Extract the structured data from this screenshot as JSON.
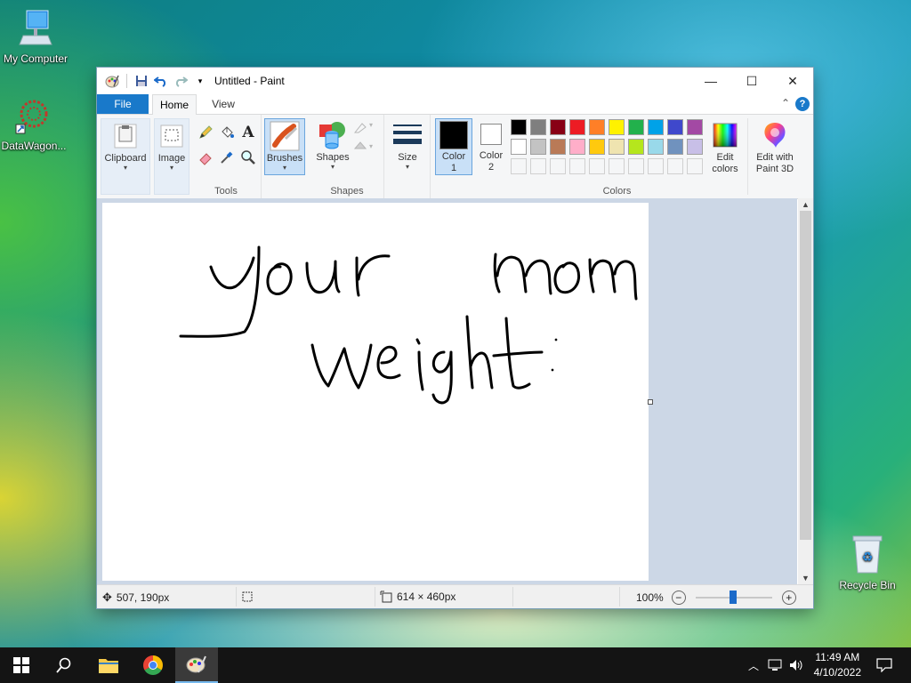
{
  "desktop": {
    "icons": [
      {
        "label": "My Computer"
      },
      {
        "label": "DataWagon..."
      },
      {
        "label": "Recycle Bin"
      }
    ]
  },
  "window": {
    "title": "Untitled - Paint",
    "controls": {
      "minimize": "—",
      "maximize": "☐",
      "close": "✕"
    }
  },
  "ribbon": {
    "tabs": [
      "File",
      "Home",
      "View"
    ],
    "help": "?",
    "clipboard": {
      "label": "Clipboard"
    },
    "image": {
      "label": "Image"
    },
    "tools": {
      "group_label": "Tools"
    },
    "brushes": {
      "label": "Brushes"
    },
    "shapes": {
      "label": "Shapes",
      "group_label": "Shapes"
    },
    "size": {
      "label": "Size"
    },
    "color1": {
      "label": "Color",
      "num": "1",
      "color": "#000000"
    },
    "color2": {
      "label": "Color",
      "num": "2",
      "color": "#ffffff"
    },
    "colors_group_label": "Colors",
    "palette_row1": [
      "#000000",
      "#7f7f7f",
      "#880015",
      "#ed1c24",
      "#ff7f27",
      "#fff200",
      "#22b14c",
      "#00a2e8",
      "#3f48cc",
      "#a349a4"
    ],
    "palette_row2": [
      "#ffffff",
      "#c3c3c3",
      "#b97a57",
      "#ffaec9",
      "#ffc90e",
      "#efe4b0",
      "#b5e61d",
      "#99d9ea",
      "#7092be",
      "#c8bfe7"
    ],
    "edit_colors": {
      "line1": "Edit",
      "line2": "colors"
    },
    "paint3d": {
      "line1": "Edit with",
      "line2": "Paint 3D"
    }
  },
  "canvas": {
    "drawing_text_line1": "your mom",
    "drawing_text_line2": "weight"
  },
  "status": {
    "cursor_pos": "507, 190px",
    "canvas_size": "614 × 460px",
    "zoom": "100%",
    "zoom_level": 1.0
  },
  "taskbar": {
    "time": "11:49 AM",
    "date": "4/10/2022"
  }
}
